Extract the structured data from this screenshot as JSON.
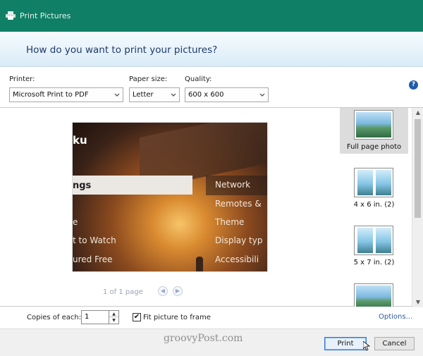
{
  "window": {
    "title": "Print Pictures"
  },
  "header": {
    "question": "How do you want to print your pictures?"
  },
  "controls": {
    "printer": {
      "label": "Printer:",
      "value": "Microsoft Print to PDF"
    },
    "paper_size": {
      "label": "Paper size:",
      "value": "Letter"
    },
    "quality": {
      "label": "Quality:",
      "value": "600 x 600"
    },
    "help_icon": "?"
  },
  "preview": {
    "logo_fragment": "ku",
    "search_fragment": "ngs",
    "left_items": [
      "e",
      "t to Watch",
      "ured Free"
    ],
    "right_items": [
      "Network",
      "Remotes &",
      "Theme",
      "Display typ",
      "Accessibili"
    ],
    "page_indicator": "1 of 1 page",
    "prev_arrow": "◀",
    "next_arrow": "▶"
  },
  "layouts": [
    {
      "label": "Full page photo",
      "selected": true
    },
    {
      "label": "4 x 6 in. (2)",
      "selected": false
    },
    {
      "label": "5 x 7 in. (2)",
      "selected": false
    }
  ],
  "scrollbar": {
    "up": "▲",
    "down": "▼"
  },
  "options": {
    "copies_label": "Copies of each:",
    "copies_value": "1",
    "spin_up": "▲",
    "spin_down": "▼",
    "fit_label": "Fit picture to frame",
    "fit_checked": "✔",
    "options_link": "Options..."
  },
  "footer": {
    "watermark": "groovyPost.com",
    "print_label": "Print",
    "cancel_label": "Cancel"
  },
  "colors": {
    "titlebar": "#0f7f66",
    "accent": "#2f7ed8",
    "question_text": "#1e3a6a"
  }
}
